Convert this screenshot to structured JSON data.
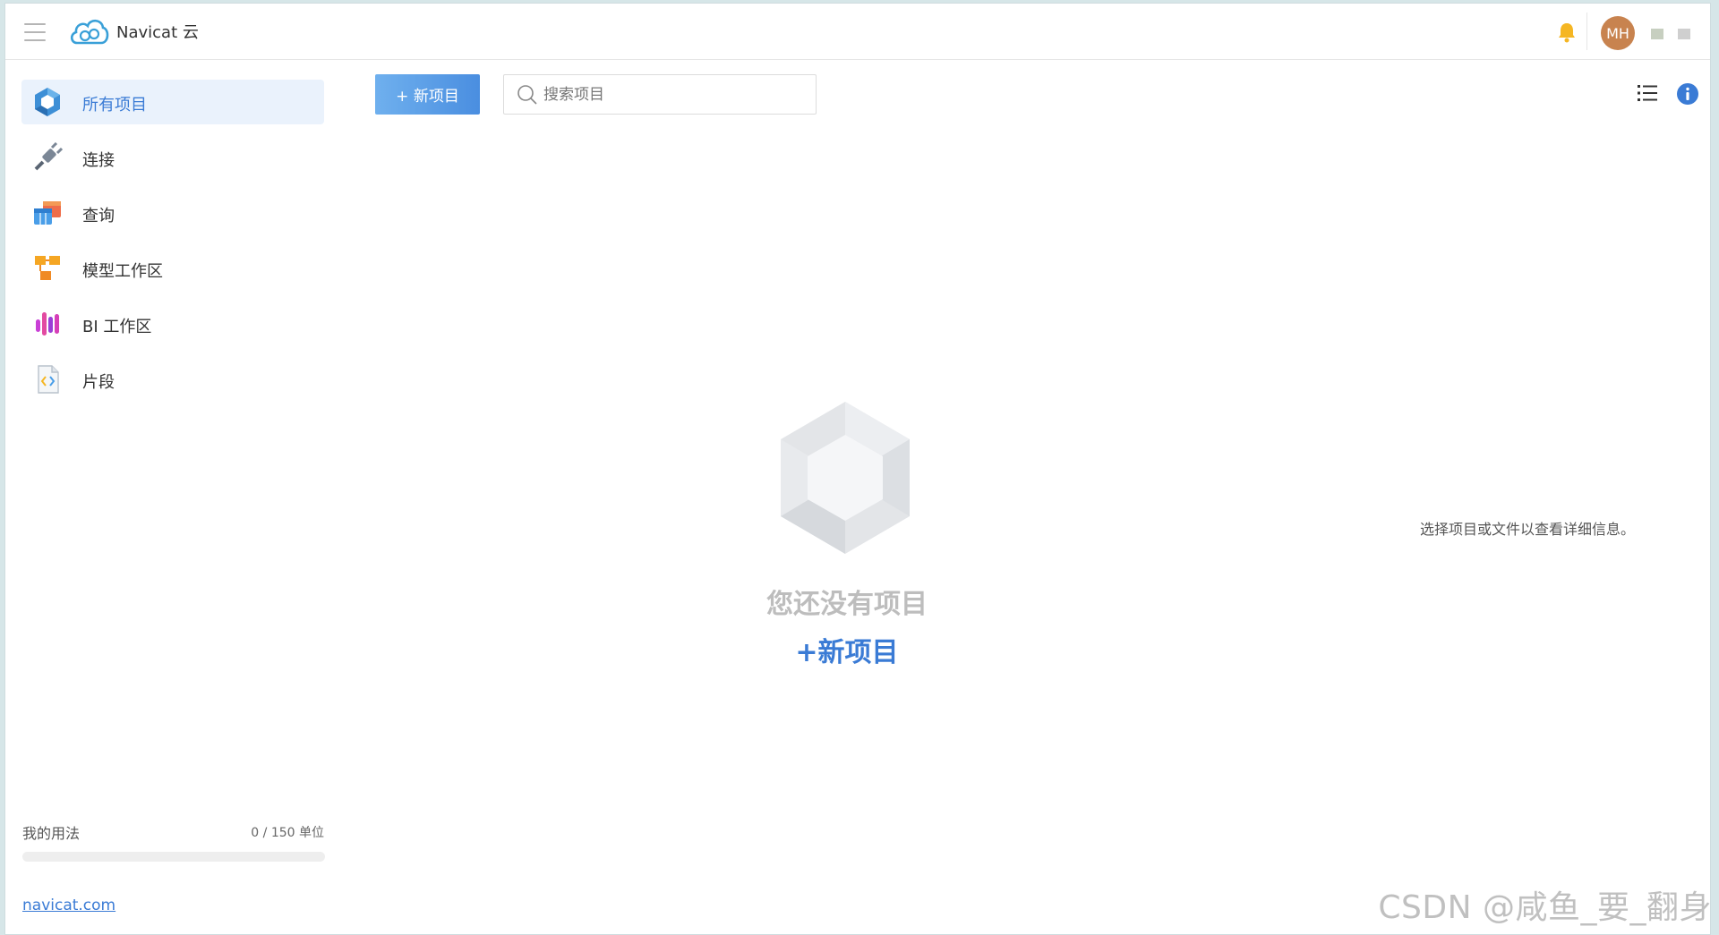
{
  "app": {
    "brand_name": "Navicat 云",
    "avatar_initials": "MH",
    "avatar_color": "#c8834f",
    "accent_color": "#3a7bd5"
  },
  "sidebar": {
    "items": [
      {
        "label": "所有项目",
        "icon": "all-projects-icon",
        "active": true
      },
      {
        "label": "连接",
        "icon": "connection-plug-icon",
        "active": false
      },
      {
        "label": "查询",
        "icon": "query-table-icon",
        "active": false
      },
      {
        "label": "模型工作区",
        "icon": "model-workspace-icon",
        "active": false
      },
      {
        "label": "BI 工作区",
        "icon": "bi-workspace-icon",
        "active": false
      },
      {
        "label": "片段",
        "icon": "snippet-file-icon",
        "active": false
      }
    ],
    "usage": {
      "label": "我的用法",
      "count": "0 / 150 单位",
      "fraction": 0
    },
    "site_link": "navicat.com"
  },
  "toolbar": {
    "new_project_label": "+ 新项目",
    "search_placeholder": "搜索项目"
  },
  "main": {
    "empty_title": "您还没有项目",
    "empty_new_label": "+新项目"
  },
  "details": {
    "hint": "选择项目或文件以查看详细信息。"
  },
  "watermark": "CSDN @咸鱼_要_翻身"
}
